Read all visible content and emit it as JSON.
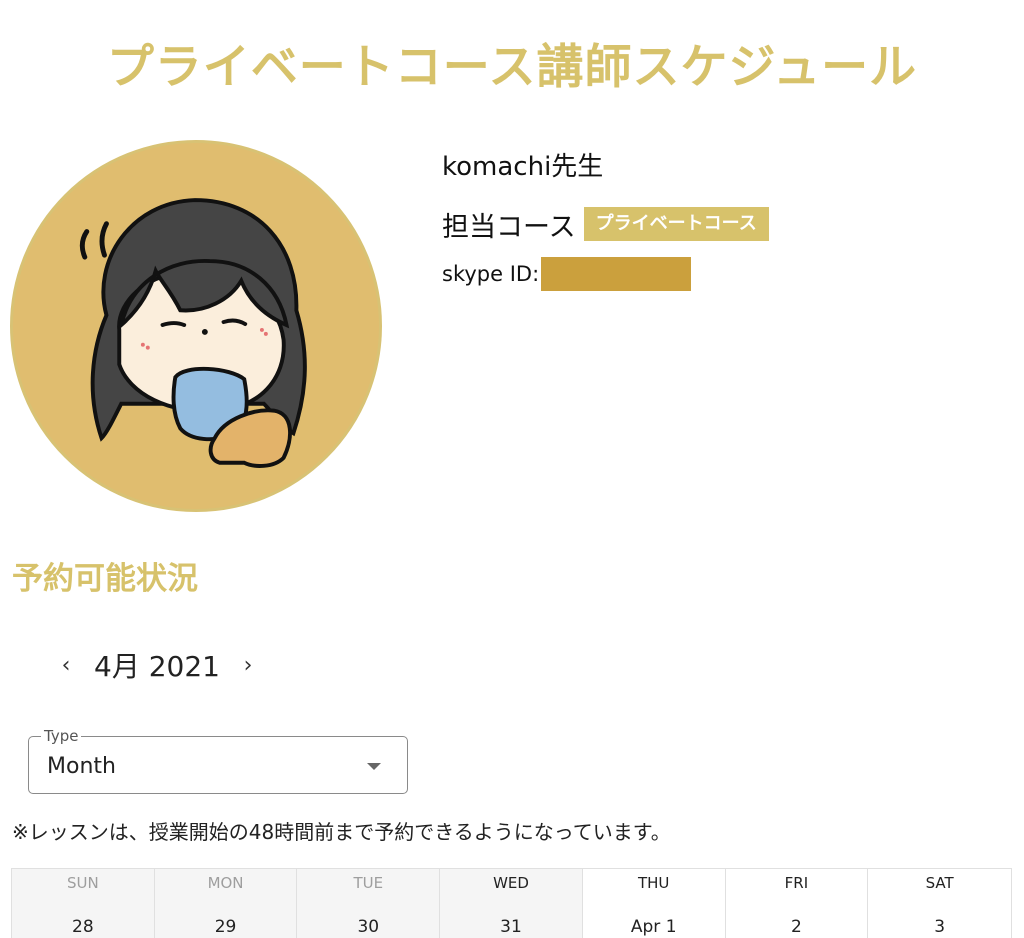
{
  "page": {
    "title": "プライベートコース講師スケジュール"
  },
  "teacher": {
    "name": "komachi先生",
    "course_label": "担当コース",
    "course_badge": "プライベートコース",
    "skype_label": "skype ID:"
  },
  "availability": {
    "section_title": "予約可能状況",
    "month_label": "4月 2021",
    "prev_icon": "chevron-left-icon",
    "next_icon": "chevron-right-icon",
    "type_legend": "Type",
    "type_value": "Month",
    "notice": "※レッスンは、授業開始の48時間前まで予約できるようになっています。"
  },
  "calendar": {
    "weekdays": [
      "SUN",
      "MON",
      "TUE",
      "WED",
      "THU",
      "FRI",
      "SAT"
    ],
    "dates": [
      "28",
      "29",
      "30",
      "31",
      "Apr 1",
      "2",
      "3"
    ]
  },
  "colors": {
    "accent": "#d7c26b",
    "avatar_bg": "#e0bd6f",
    "redaction": "#cba03d"
  }
}
